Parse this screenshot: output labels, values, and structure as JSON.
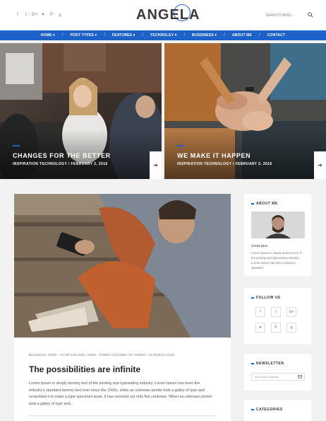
{
  "header": {
    "social_icons": [
      "facebook-icon",
      "twitter-icon",
      "google-plus-icon",
      "heart-icon",
      "pinterest-icon",
      "instagram-icon"
    ],
    "social_glyphs": [
      "f",
      "t",
      "G+",
      "♥",
      "P",
      "◎"
    ],
    "logo": "ANGELA",
    "search_placeholder": "SEARCH HERE..."
  },
  "nav": {
    "items": [
      {
        "label": "HOME ▾"
      },
      {
        "label": "POST TYPES ▾"
      },
      {
        "label": "FEATURES ▾"
      },
      {
        "label": "TECHNOLGY ▾"
      },
      {
        "label": "BUSSINESS ▾"
      },
      {
        "label": "ABOUT ME"
      },
      {
        "label": "CONTACT"
      }
    ],
    "separator": "/"
  },
  "hero": [
    {
      "title": "CHANGES FOR THE BETTER",
      "meta": "INSPIRATION TECHNOLOGY / FEBRUARY 2, 2016",
      "arrow": "➔"
    },
    {
      "title": "WE MAKE IT HAPPEN",
      "meta": "INSPIRATION TECHNOLOGY / FEBRUARY 2, 2016",
      "arrow": "➔"
    }
  ],
  "post": {
    "meta": "BUSINESS, GRID - YOUR COLUMN, GRID - THREE COLUMN / BY ADMIN / 19 MARCH 2016",
    "title": "The possibilities are infinite",
    "excerpt": "Lorem Ipsum is simply dummy text of the printing and typesetting industry. Lorem Ipsum has been the industry's standard dummy text ever since the 1500s, when an unknown printer took a galley of type and scrambled it to make a type specimen book. It has survived not only five centuries. When an unknown printer took a galley of type and..."
  },
  "sidebar": {
    "about": {
      "title": "ABOUT ME",
      "name": "JOHN DEO",
      "bio": "Lorem Ipsum is simply dummy text of the printing and typesetting industry. Lorem Ipsum has been industry's standard."
    },
    "follow": {
      "title": "FOLLOW US",
      "icons": [
        {
          "name": "facebook-icon",
          "glyph": "f"
        },
        {
          "name": "twitter-icon",
          "glyph": "t"
        },
        {
          "name": "google-plus-icon",
          "glyph": "G+"
        },
        {
          "name": "heart-icon",
          "glyph": "♥"
        },
        {
          "name": "pinterest-icon",
          "glyph": "P"
        },
        {
          "name": "instagram-icon",
          "glyph": "◎"
        }
      ]
    },
    "newsletter": {
      "title": "NEWSLETTER",
      "placeholder": "Your Email Address"
    },
    "categories": {
      "title": "CATEGORIES"
    }
  }
}
